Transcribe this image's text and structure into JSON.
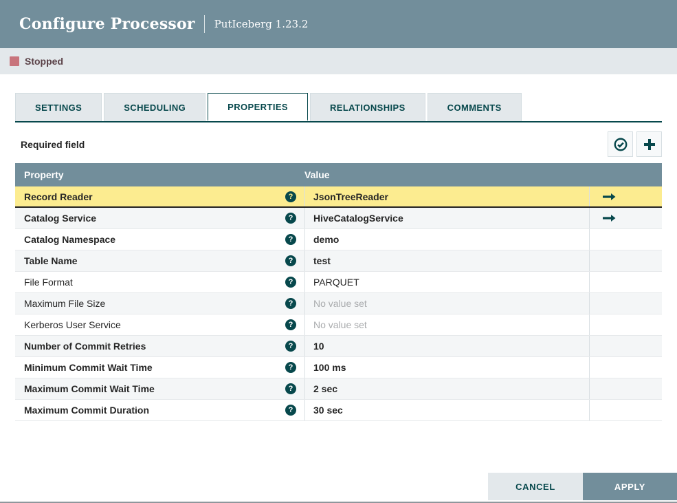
{
  "header": {
    "title": "Configure Processor",
    "subtitle": "PutIceberg 1.23.2"
  },
  "status": {
    "label": "Stopped"
  },
  "tabs": [
    {
      "label": "SETTINGS",
      "active": false
    },
    {
      "label": "SCHEDULING",
      "active": false
    },
    {
      "label": "PROPERTIES",
      "active": true
    },
    {
      "label": "RELATIONSHIPS",
      "active": false
    },
    {
      "label": "COMMENTS",
      "active": false
    }
  ],
  "properties_panel": {
    "required_hint": "Required field",
    "toolbar_icons": [
      "check-circle-icon",
      "plus-icon"
    ],
    "table": {
      "columns": [
        "Property",
        "Value"
      ],
      "rows": [
        {
          "property": "Record Reader",
          "value": "JsonTreeReader",
          "required": true,
          "selected": true,
          "has_goto": true,
          "unset": false
        },
        {
          "property": "Catalog Service",
          "value": "HiveCatalogService",
          "required": true,
          "selected": false,
          "has_goto": true,
          "unset": false
        },
        {
          "property": "Catalog Namespace",
          "value": "demo",
          "required": true,
          "selected": false,
          "has_goto": false,
          "unset": false
        },
        {
          "property": "Table Name",
          "value": "test",
          "required": true,
          "selected": false,
          "has_goto": false,
          "unset": false
        },
        {
          "property": "File Format",
          "value": "PARQUET",
          "required": false,
          "selected": false,
          "has_goto": false,
          "unset": false
        },
        {
          "property": "Maximum File Size",
          "value": "No value set",
          "required": false,
          "selected": false,
          "has_goto": false,
          "unset": true
        },
        {
          "property": "Kerberos User Service",
          "value": "No value set",
          "required": false,
          "selected": false,
          "has_goto": false,
          "unset": true
        },
        {
          "property": "Number of Commit Retries",
          "value": "10",
          "required": true,
          "selected": false,
          "has_goto": false,
          "unset": false
        },
        {
          "property": "Minimum Commit Wait Time",
          "value": "100 ms",
          "required": true,
          "selected": false,
          "has_goto": false,
          "unset": false
        },
        {
          "property": "Maximum Commit Wait Time",
          "value": "2 sec",
          "required": true,
          "selected": false,
          "has_goto": false,
          "unset": false
        },
        {
          "property": "Maximum Commit Duration",
          "value": "30 sec",
          "required": true,
          "selected": false,
          "has_goto": false,
          "unset": false
        }
      ]
    }
  },
  "footer": {
    "cancel_label": "CANCEL",
    "apply_label": "APPLY"
  },
  "colors": {
    "header_bg": "#728E9B",
    "status_bar_bg": "#E3E8EB",
    "stopped_square": "#C8747C",
    "stopped_text": "#5A4147",
    "primary_teal": "#07484C",
    "table_header_bg": "#728E9B",
    "selected_row_bg": "#FCEC90",
    "row_alt_bg": "#F4F6F7",
    "unset_text": "#A9ABAD",
    "cell_text": "#262626"
  }
}
